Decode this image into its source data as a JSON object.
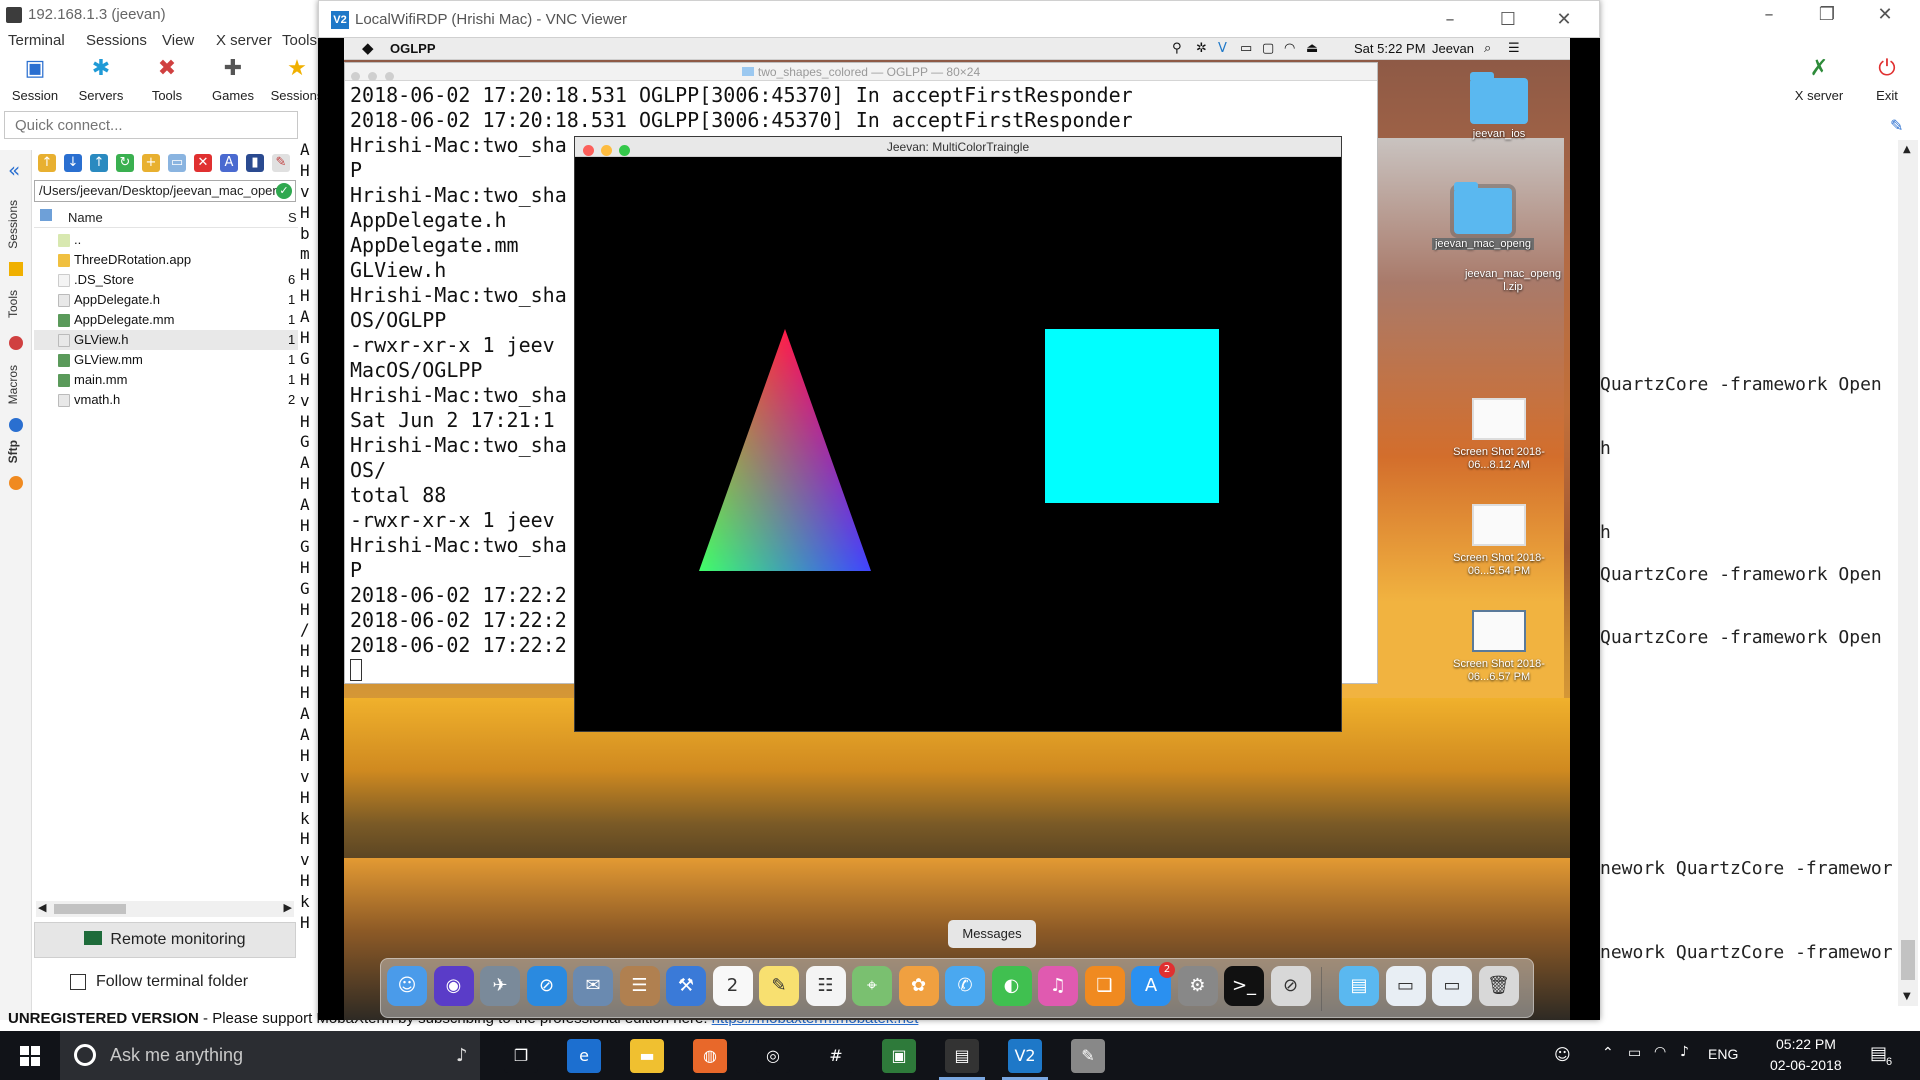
{
  "moba": {
    "title": "192.168.1.3 (jeevan)",
    "menu": [
      "Terminal",
      "Sessions",
      "View",
      "X server",
      "Tools"
    ],
    "toolbar": [
      {
        "label": "Session",
        "icon": "session-icon",
        "color": "#2a6fd0",
        "glyph": "▣"
      },
      {
        "label": "Servers",
        "icon": "servers-icon",
        "color": "#1f9ad6",
        "glyph": "✱"
      },
      {
        "label": "Tools",
        "icon": "tools-icon",
        "color": "#d04040",
        "glyph": "✖"
      },
      {
        "label": "Games",
        "icon": "games-icon",
        "color": "#555555",
        "glyph": "✚"
      },
      {
        "label": "Sessions",
        "icon": "sessions-star-icon",
        "color": "#f0b000",
        "glyph": "★"
      }
    ],
    "toolbar_right": [
      {
        "label": "X server",
        "icon": "x-server-icon",
        "glyph": "✗",
        "color": "#2e8b3a"
      },
      {
        "label": "Exit",
        "icon": "exit-power-icon",
        "glyph": "⏻",
        "color": "#e03030"
      }
    ],
    "quick_connect_placeholder": "Quick connect...",
    "side_tabs": [
      "Sessions",
      "Tools",
      "Macros",
      "Sftp"
    ],
    "sftp": {
      "path": "/Users/jeevan/Desktop/jeevan_mac_open",
      "header_name": "Name",
      "header_size": "S",
      "files": [
        {
          "name": "..",
          "size": "",
          "icon": "parent-folder-icon",
          "color": "#d8e8b0"
        },
        {
          "name": "ThreeDRotation.app",
          "size": "",
          "icon": "folder-icon",
          "color": "#f0c040"
        },
        {
          "name": ".DS_Store",
          "size": "6",
          "icon": "file-icon",
          "color": "#f4f4f4"
        },
        {
          "name": "AppDelegate.h",
          "size": "1",
          "icon": "h-file-icon",
          "color": "#e8e8e8"
        },
        {
          "name": "AppDelegate.mm",
          "size": "1",
          "icon": "mm-file-icon",
          "color": "#5a9a5a"
        },
        {
          "name": "GLView.h",
          "size": "1",
          "icon": "h-file-icon",
          "color": "#e8e8e8",
          "selected": true
        },
        {
          "name": "GLView.mm",
          "size": "1",
          "icon": "mm-file-icon",
          "color": "#5a9a5a"
        },
        {
          "name": "main.mm",
          "size": "1",
          "icon": "mm-file-icon",
          "color": "#5a9a5a"
        },
        {
          "name": "vmath.h",
          "size": "2",
          "icon": "h-file-icon",
          "color": "#e8e8e8"
        }
      ],
      "remote_monitoring": "Remote monitoring",
      "follow_folder": "Follow terminal folder"
    },
    "terminal_strip": [
      "A",
      "H",
      "v",
      "H",
      "b",
      "m",
      "H",
      "H",
      "A",
      "H",
      "G",
      "H",
      "v",
      "H",
      "G",
      "A",
      "H",
      "A",
      "H",
      "G",
      "H",
      "G",
      "H",
      "/",
      "H",
      "H",
      "H",
      "A",
      "A",
      "H",
      "v",
      "H",
      "k",
      "H",
      "v",
      "H",
      "k",
      "H"
    ],
    "right_terminal": [
      {
        "text": "QuartzCore -framework Open",
        "row": 0
      },
      {
        "text": "h",
        "row": 1
      },
      {
        "text": "h",
        "row": 2
      },
      {
        "text": "QuartzCore -framework Open",
        "row": 3
      },
      {
        "text": "QuartzCore -framework Open",
        "row": 4
      },
      {
        "text": "nework QuartzCore -framewor",
        "row": 5
      },
      {
        "text": "nework QuartzCore -framewor",
        "row": 6
      }
    ],
    "status_unregistered": "UNREGISTERED VERSION",
    "status_text": " -  Please support MobaXterm by subscribing to the professional edition here: ",
    "status_link": "https://mobaxterm.mobatek.net"
  },
  "vnc": {
    "title": "LocalWifiRDP (Hrishi Mac) - VNC Viewer",
    "icon_text": "V2",
    "mac_menubar": {
      "app": "OGLPP",
      "clock": "Sat 5:22 PM",
      "user": "Jeevan"
    },
    "terminal": {
      "title": "two_shapes_colored — OGLPP — 80×24",
      "lines": [
        "2018-06-02 17:20:18.531 OGLPP[3006:45370] In acceptFirstResponder",
        "2018-06-02 17:20:18.531 OGLPP[3006:45370] In acceptFirstResponder",
        "Hrishi-Mac:two_sha",
        "P",
        "Hrishi-Mac:two_sha",
        "AppDelegate.h",
        "AppDelegate.mm",
        "GLView.h",
        "Hrishi-Mac:two_sha",
        "OS/OGLPP",
        "-rwxr-xr-x  1 jeev",
        "MacOS/OGLPP",
        "Hrishi-Mac:two_sha",
        "Sat Jun  2 17:21:1",
        "Hrishi-Mac:two_sha",
        "OS/",
        "total 88",
        "-rwxr-xr-x  1 jeev",
        "Hrishi-Mac:two_sha",
        "P",
        "2018-06-02 17:22:2",
        "2018-06-02 17:22:2",
        "2018-06-02 17:22:2"
      ]
    },
    "gl_window": {
      "title": "Jeevan: MultiColorTraingle",
      "triangle_colors": [
        "#ff0000",
        "#00ff00",
        "#0000ff"
      ],
      "square_color": "#00ffff"
    },
    "desktop_icons": [
      {
        "label": "jeevan_ios",
        "type": "folder"
      },
      {
        "label": "jeevan_mac_openg",
        "type": "folder"
      },
      {
        "label": "jeevan_mac_openg l.zip",
        "type": "zip"
      },
      {
        "label": "Screen Shot 2018-06...8.12 AM",
        "type": "shot"
      },
      {
        "label": "Screen Shot 2018-06...5.54 PM",
        "type": "shot"
      },
      {
        "label": "Screen Shot 2018-06...6.57 PM",
        "type": "shot"
      }
    ],
    "dock_tooltip": "Messages",
    "dock": [
      {
        "name": "finder",
        "color": "#4a9bea",
        "glyph": "☺"
      },
      {
        "name": "siri",
        "color": "#5a3cc8",
        "glyph": "◉"
      },
      {
        "name": "launchpad",
        "color": "#7a8a9a",
        "glyph": "✈"
      },
      {
        "name": "safari",
        "color": "#2a8ae0",
        "glyph": "⊘"
      },
      {
        "name": "mail",
        "color": "#6a8ab0",
        "glyph": "✉"
      },
      {
        "name": "contacts",
        "color": "#b08050",
        "glyph": "☰"
      },
      {
        "name": "xcode",
        "color": "#3a7ad8",
        "glyph": "⚒"
      },
      {
        "name": "calendar",
        "color": "#f8f8f8",
        "glyph": "2"
      },
      {
        "name": "notes",
        "color": "#f8e070",
        "glyph": "✎"
      },
      {
        "name": "reminders",
        "color": "#f4f4f4",
        "glyph": "☷"
      },
      {
        "name": "maps",
        "color": "#7ac070",
        "glyph": "⌖"
      },
      {
        "name": "photos",
        "color": "#f0a040",
        "glyph": "✿"
      },
      {
        "name": "messages",
        "color": "#4aa8f0",
        "glyph": "✆"
      },
      {
        "name": "facetime",
        "color": "#40c050",
        "glyph": "◐"
      },
      {
        "name": "itunes",
        "color": "#e05ab0",
        "glyph": "♫"
      },
      {
        "name": "ibooks",
        "color": "#f08a20",
        "glyph": "❑"
      },
      {
        "name": "app-store",
        "color": "#2a90f0",
        "glyph": "A",
        "badge": "2"
      },
      {
        "name": "system-preferences",
        "color": "#888888",
        "glyph": "⚙"
      },
      {
        "name": "terminal",
        "color": "#111111",
        "glyph": ">_"
      },
      {
        "name": "no-entry",
        "color": "#d8d8d8",
        "glyph": "⊘"
      },
      {
        "name": "downloads-folder",
        "color": "#5ab8f0",
        "glyph": "▤"
      },
      {
        "name": "stack-1",
        "color": "#e8eef4",
        "glyph": "▭"
      },
      {
        "name": "stack-2",
        "color": "#e8eef4",
        "glyph": "▭"
      },
      {
        "name": "trash",
        "color": "#d8d8d8",
        "glyph": "🗑"
      }
    ]
  },
  "taskbar": {
    "search_placeholder": "Ask me anything",
    "items": [
      {
        "name": "task-view",
        "glyph": "❐",
        "color": "#111318"
      },
      {
        "name": "edge",
        "glyph": "e",
        "color": "#1c6fd0"
      },
      {
        "name": "file-explorer",
        "glyph": "▬",
        "color": "#f0c030"
      },
      {
        "name": "firefox",
        "glyph": "◍",
        "color": "#e8682a"
      },
      {
        "name": "chrome-like",
        "glyph": "◎",
        "color": "#111318"
      },
      {
        "name": "slack",
        "glyph": "#",
        "color": "#111318"
      },
      {
        "name": "image-viewer",
        "glyph": "▣",
        "color": "#2e7a3a"
      },
      {
        "name": "mobaxterm",
        "glyph": "▤",
        "color": "#333333",
        "active": true
      },
      {
        "name": "vnc-viewer",
        "glyph": "V2",
        "color": "#1e78c8",
        "active": true
      },
      {
        "name": "paint",
        "glyph": "✎",
        "color": "#888888"
      }
    ],
    "tray": {
      "language": "ENG",
      "time": "05:22 PM",
      "date": "02-06-2018",
      "notifications": "6"
    }
  }
}
